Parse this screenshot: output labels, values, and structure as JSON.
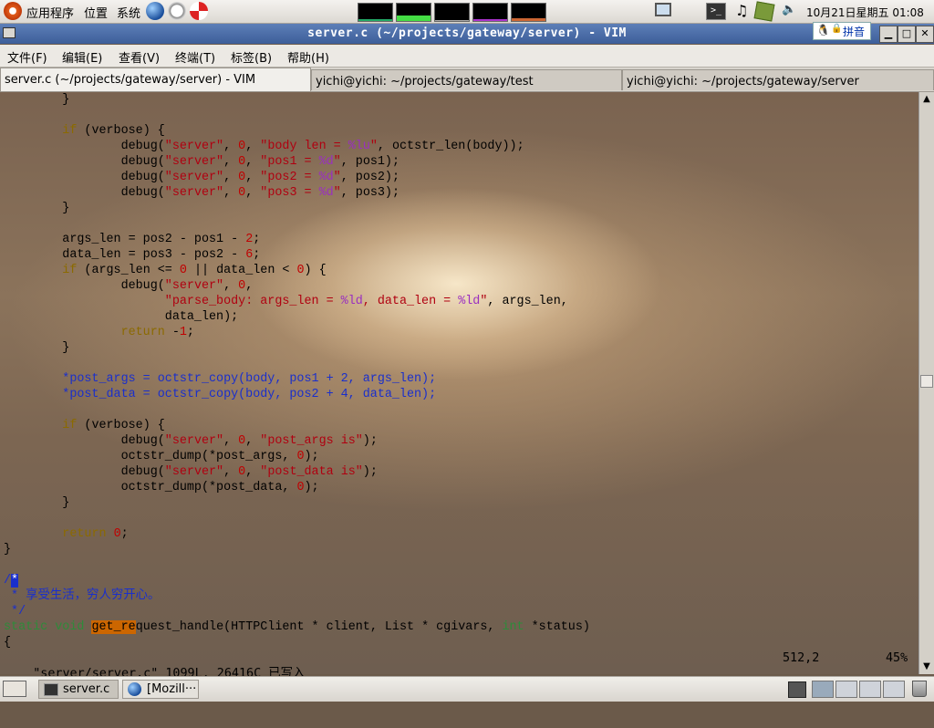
{
  "top_panel": {
    "menus": [
      "应用程序",
      "位置",
      "系统"
    ],
    "clock": "10月21日星期五 01:08",
    "ime": "拼音"
  },
  "window": {
    "title": "server.c (~/projects/gateway/server) - VIM"
  },
  "menubar": {
    "items": [
      "文件(F)",
      "编辑(E)",
      "查看(V)",
      "终端(T)",
      "标签(B)",
      "帮助(H)"
    ]
  },
  "tabs": [
    {
      "label": "server.c (~/projects/gateway/server) - VIM"
    },
    {
      "label": "yichi@yichi: ~/projects/gateway/test"
    },
    {
      "label": "yichi@yichi: ~/projects/gateway/server"
    }
  ],
  "status": {
    "message": "\"server/server.c\" 1099L, 26416C 已写入",
    "cursor": "512,2",
    "percent": "45%"
  },
  "taskbar": {
    "items": [
      "server.c",
      "[Mozill···"
    ]
  },
  "colors": {
    "keyword": "#8b6a00",
    "string": "#b00010",
    "number": "#c00000",
    "format": "#9a2fc0",
    "comment": "#1a2fcc",
    "type": "#2e8b3a",
    "title_bar": "#4a6ba5"
  },
  "code_lines": [
    "        }",
    "",
    "        if (verbose) {",
    "                debug(\"server\", 0, \"body len = %lu\", octstr_len(body));",
    "                debug(\"server\", 0, \"pos1 = %d\", pos1);",
    "                debug(\"server\", 0, \"pos2 = %d\", pos2);",
    "                debug(\"server\", 0, \"pos3 = %d\", pos3);",
    "        }",
    "",
    "        args_len = pos2 - pos1 - 2;",
    "        data_len = pos3 - pos2 - 6;",
    "        if (args_len <= 0 || data_len < 0) {",
    "                debug(\"server\", 0,",
    "                      \"parse_body: args_len = %ld, data_len = %ld\", args_len,",
    "                      data_len);",
    "                return -1;",
    "        }",
    "",
    "        *post_args = octstr_copy(body, pos1 + 2, args_len);",
    "        *post_data = octstr_copy(body, pos2 + 4, data_len);",
    "",
    "        if (verbose) {",
    "                debug(\"server\", 0, \"post_args is\");",
    "                octstr_dump(*post_args, 0);",
    "                debug(\"server\", 0, \"post_data is\");",
    "                octstr_dump(*post_data, 0);",
    "        }",
    "",
    "        return 0;",
    "}",
    "",
    "/*",
    " * 享受生活，穷人穷开心。",
    " */",
    "static void get_request_handle(HTTPClient * client, List * cgivars, int *status)",
    "{"
  ]
}
